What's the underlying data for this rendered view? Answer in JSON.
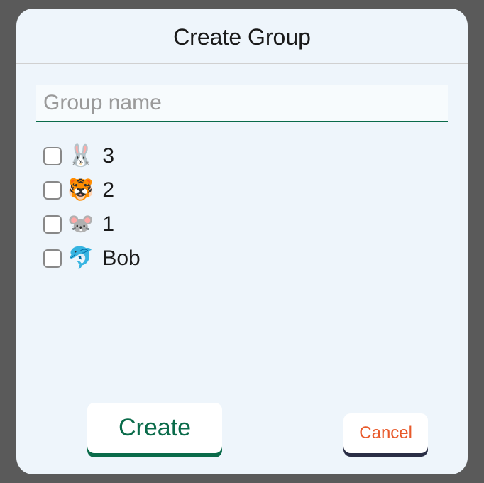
{
  "dialog": {
    "title": "Create Group"
  },
  "input": {
    "placeholder": "Group name",
    "value": ""
  },
  "contacts": [
    {
      "avatar": "🐰",
      "name": "3",
      "checked": false
    },
    {
      "avatar": "🐯",
      "name": "2",
      "checked": false
    },
    {
      "avatar": "🐭",
      "name": "1",
      "checked": false
    },
    {
      "avatar": "🐬",
      "name": "Bob",
      "checked": false
    }
  ],
  "buttons": {
    "create": "Create",
    "cancel": "Cancel"
  }
}
